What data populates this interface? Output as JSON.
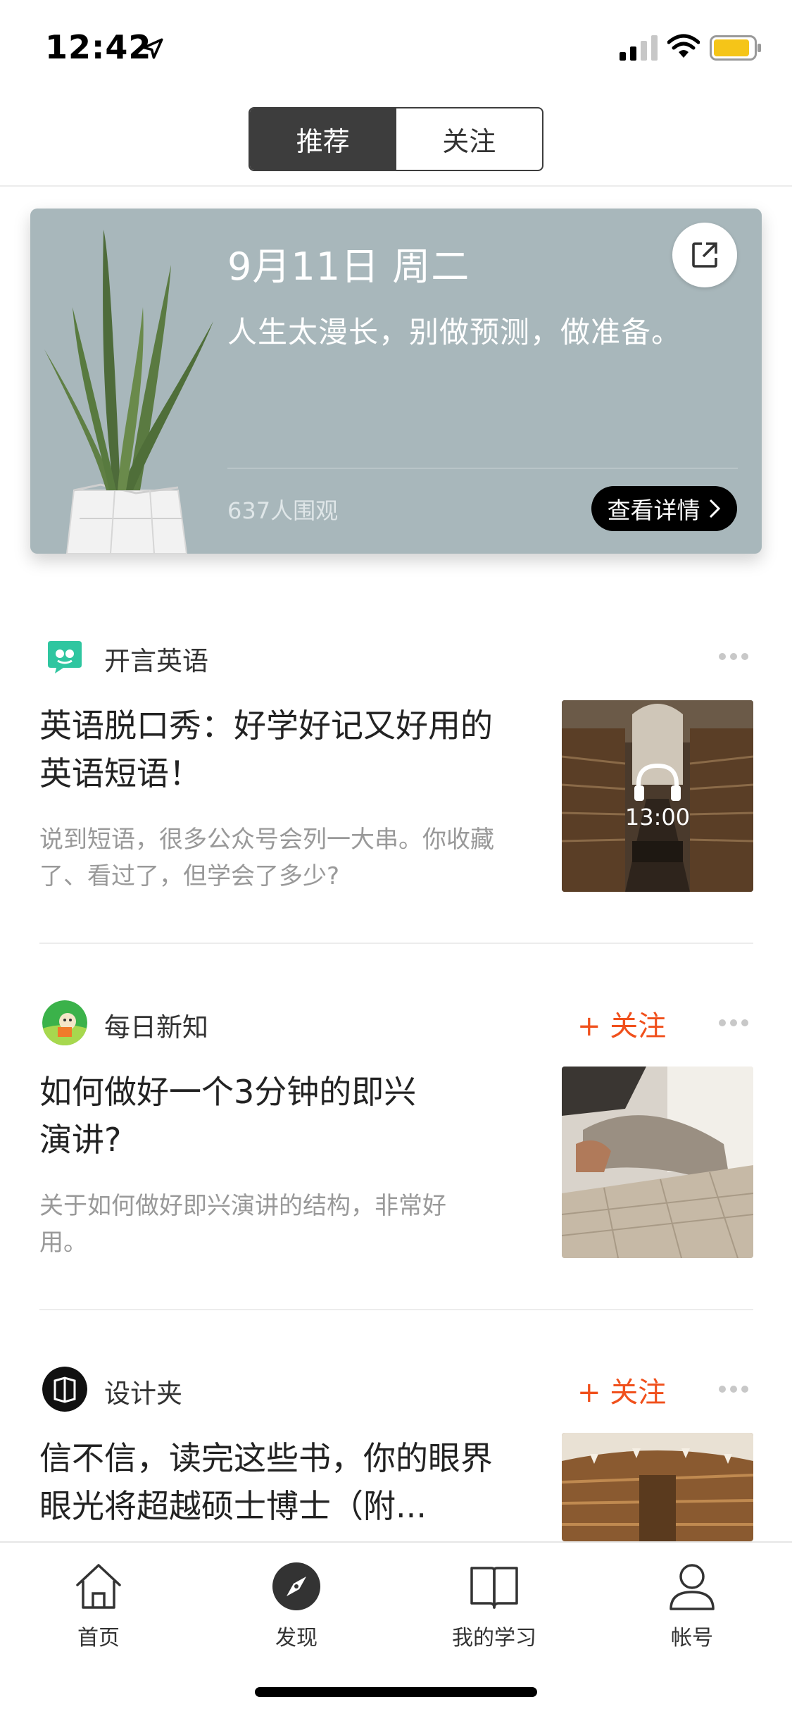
{
  "status_bar": {
    "time": "12:42"
  },
  "segments": {
    "recommend": "推荐",
    "follow": "关注"
  },
  "daily_card": {
    "date": "9月11日  周二",
    "quote": "人生太漫长，别做预测，做准备。",
    "views": "637人围观",
    "detail_button": "查看详情"
  },
  "feed": [
    {
      "source": "开言英语",
      "title": "英语脱口秀：好学好记又好用的英语短语！",
      "desc": "说到短语，很多公众号会列一大串。你收藏了、看过了，但学会了多少?",
      "audio_time": "13:00"
    },
    {
      "source": "每日新知",
      "follow": "+ 关注",
      "title": "如何做好一个3分钟的即兴演讲?",
      "desc": "关于如何做好即兴演讲的结构，非常好用。"
    },
    {
      "source": "设计夹",
      "follow": "+ 关注",
      "title": "信不信，读完这些书，你的眼界眼光将超越硕士博士（附..."
    }
  ],
  "tabbar": {
    "home": "首页",
    "discover": "发现",
    "my_learning": "我的学习",
    "account": "帐号"
  },
  "colors": {
    "accent": "#f0501c",
    "card_bg": "#a8b7bb",
    "segment_active": "#3d3d3d"
  }
}
